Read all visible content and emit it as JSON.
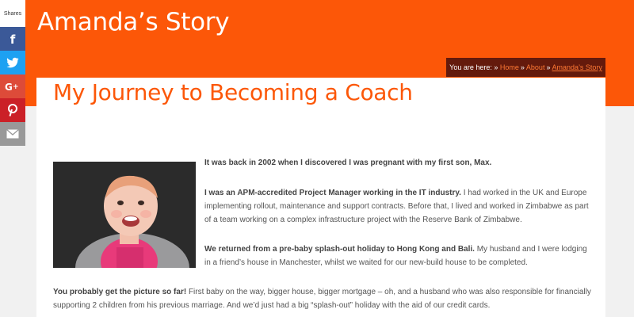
{
  "header": {
    "site_title": "Amanda’s Story"
  },
  "breadcrumb": {
    "prefix": "You are here: »",
    "items": [
      "Home",
      "About",
      "Amanda’s Story"
    ],
    "separator": "»"
  },
  "share": {
    "label": "Shares",
    "buttons": [
      {
        "name": "facebook",
        "icon": "facebook-icon",
        "color": "#3b5998"
      },
      {
        "name": "twitter",
        "icon": "twitter-icon",
        "color": "#1da1f2"
      },
      {
        "name": "google-plus",
        "icon": "google-plus-icon",
        "color": "#dd4b39"
      },
      {
        "name": "pinterest",
        "icon": "pinterest-icon",
        "color": "#cb2027"
      },
      {
        "name": "email",
        "icon": "mail-icon",
        "color": "#999999"
      }
    ]
  },
  "page": {
    "title": "My Journey to Becoming a Coach"
  },
  "article": {
    "p1_bold": "It was back in 2002 when I discovered I was pregnant with my first son, Max.",
    "p2_bold": "I was an APM-accredited Project Manager working in the IT industry.",
    "p2_text": " I had worked in the UK and Europe implementing rollout, maintenance and support contracts. Before that, I lived and worked in Zimbabwe as part of a team working on a complex infrastructure project with the Reserve Bank of Zimbabwe.",
    "p3_bold": "We returned from a pre-baby splash-out holiday to Hong Kong and Bali.",
    "p3_text": " My husband and I were lodging in a friend’s house in Manchester, whilst we waited for our new-build house to be completed.",
    "p4_bold": "You probably get the picture so far!",
    "p4_text": "  First baby on the way, bigger house, bigger mortgage – oh, and a husband who was also responsible for financially supporting 2 children from his previous marriage. And we’d just had a big “splash-out” holiday with the aid of our credit cards."
  },
  "colors": {
    "brand_orange": "#fc5708",
    "breadcrumb_bg": "#641a0c",
    "link": "#ff7a35"
  }
}
